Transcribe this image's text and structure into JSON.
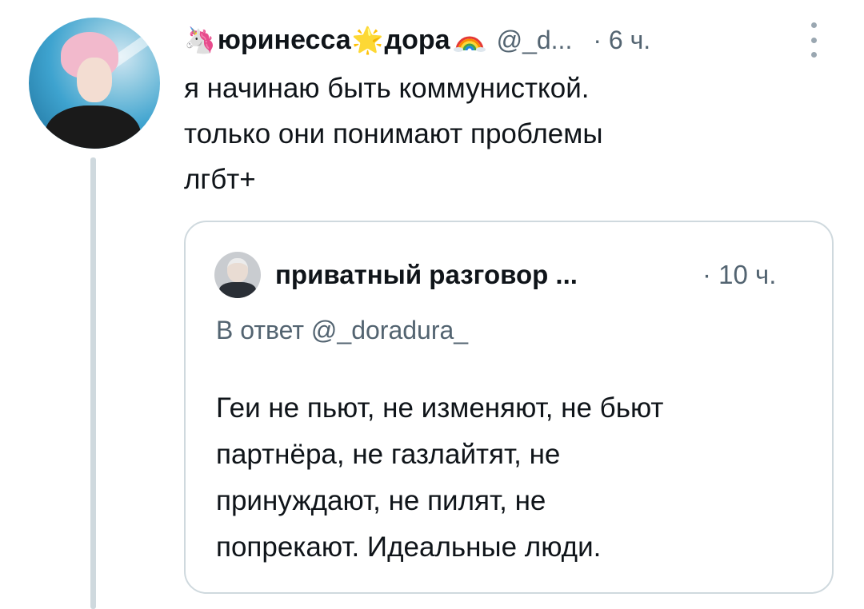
{
  "tweet": {
    "author_name": "юринесса",
    "author_name_part2": "дора",
    "emoji_unicorn": "🦄",
    "emoji_star": "🌟",
    "emoji_rainbow": "🌈",
    "handle": "@_d...",
    "time": "· 6 ч.",
    "text_lines": [
      "я начинаю быть коммунисткой.",
      "только они понимают проблемы",
      "лгбт+"
    ]
  },
  "quote": {
    "author_name": "приватный разговор ...",
    "time": "· 10 ч.",
    "reply_to": "В ответ @_doradura_",
    "text_lines": [
      "Геи не пьют, не изменяют, не бьют",
      "партнёра, не газлайтят, не",
      "принуждают, не пилят, не",
      "попрекают. Идеальные люди."
    ]
  },
  "colors": {
    "text_primary": "#0f1419",
    "text_secondary": "#536471",
    "border": "#cfd9de"
  },
  "icons": {
    "more": "more-vertical-icon"
  }
}
